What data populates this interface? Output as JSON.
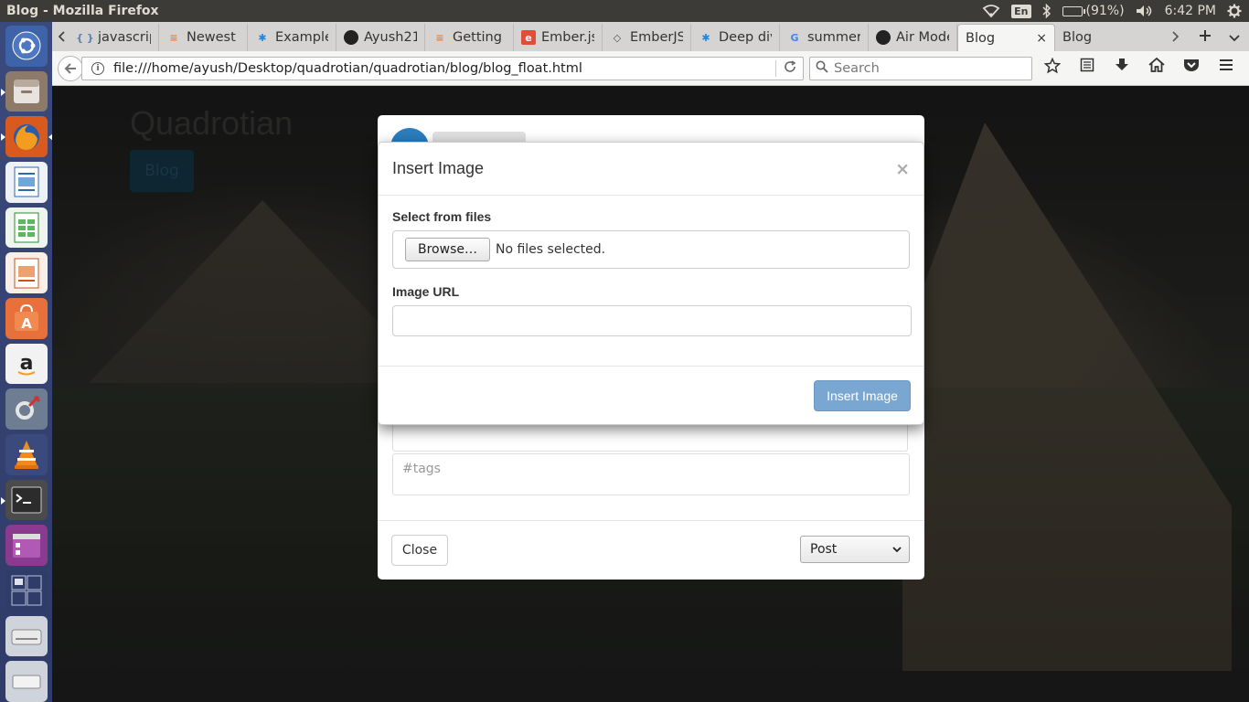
{
  "window": {
    "title": "Blog - Mozilla Firefox"
  },
  "indicators": {
    "keyboard": "En",
    "battery": "(91%)",
    "battery_fraction": 0.91,
    "time": "6:42 PM"
  },
  "launcher": {
    "items": [
      "ubuntu-dash-icon",
      "files-icon",
      "firefox-icon",
      "writer-icon",
      "calc-icon",
      "impress-icon",
      "software-center-icon",
      "amazon-icon",
      "settings-icon",
      "vlc-icon",
      "terminal-icon",
      "app-icon",
      "workspaces-icon",
      "drive-icon",
      "trash-icon"
    ]
  },
  "tabs": [
    {
      "label": "javascrip",
      "icon": "code-icon"
    },
    {
      "label": "Newest",
      "icon": "stack-overflow-icon"
    },
    {
      "label": "Example",
      "icon": "gear-icon"
    },
    {
      "label": "Ayush21",
      "icon": "github-icon"
    },
    {
      "label": "Getting",
      "icon": "stack-overflow-icon"
    },
    {
      "label": "Ember.js",
      "icon": "ember-icon"
    },
    {
      "label": "EmberJS",
      "icon": "diamond-icon"
    },
    {
      "label": "Deep div",
      "icon": "gear-icon"
    },
    {
      "label": "summer",
      "icon": "google-icon"
    },
    {
      "label": "Air Mode",
      "icon": "github-icon"
    }
  ],
  "active_tab": {
    "label": "Blog",
    "close": "×"
  },
  "next_tab": {
    "label": "Blog"
  },
  "urlbar": {
    "url": "file:///home/ayush/Desktop/quadrotian/quadrotian/blog/blog_float.html"
  },
  "searchbar": {
    "placeholder": "Search"
  },
  "page": {
    "site_title": "Quadrotian",
    "site_button": "Blog"
  },
  "back_modal": {
    "tags_placeholder": "#tags",
    "close_label": "Close",
    "select_value": "Post"
  },
  "insert_modal": {
    "title": "Insert Image",
    "close_x": "×",
    "files_label": "Select from files",
    "browse_label": "Browse…",
    "file_status": "No files selected.",
    "url_label": "Image URL",
    "url_value": "",
    "insert_label": "Insert Image"
  }
}
